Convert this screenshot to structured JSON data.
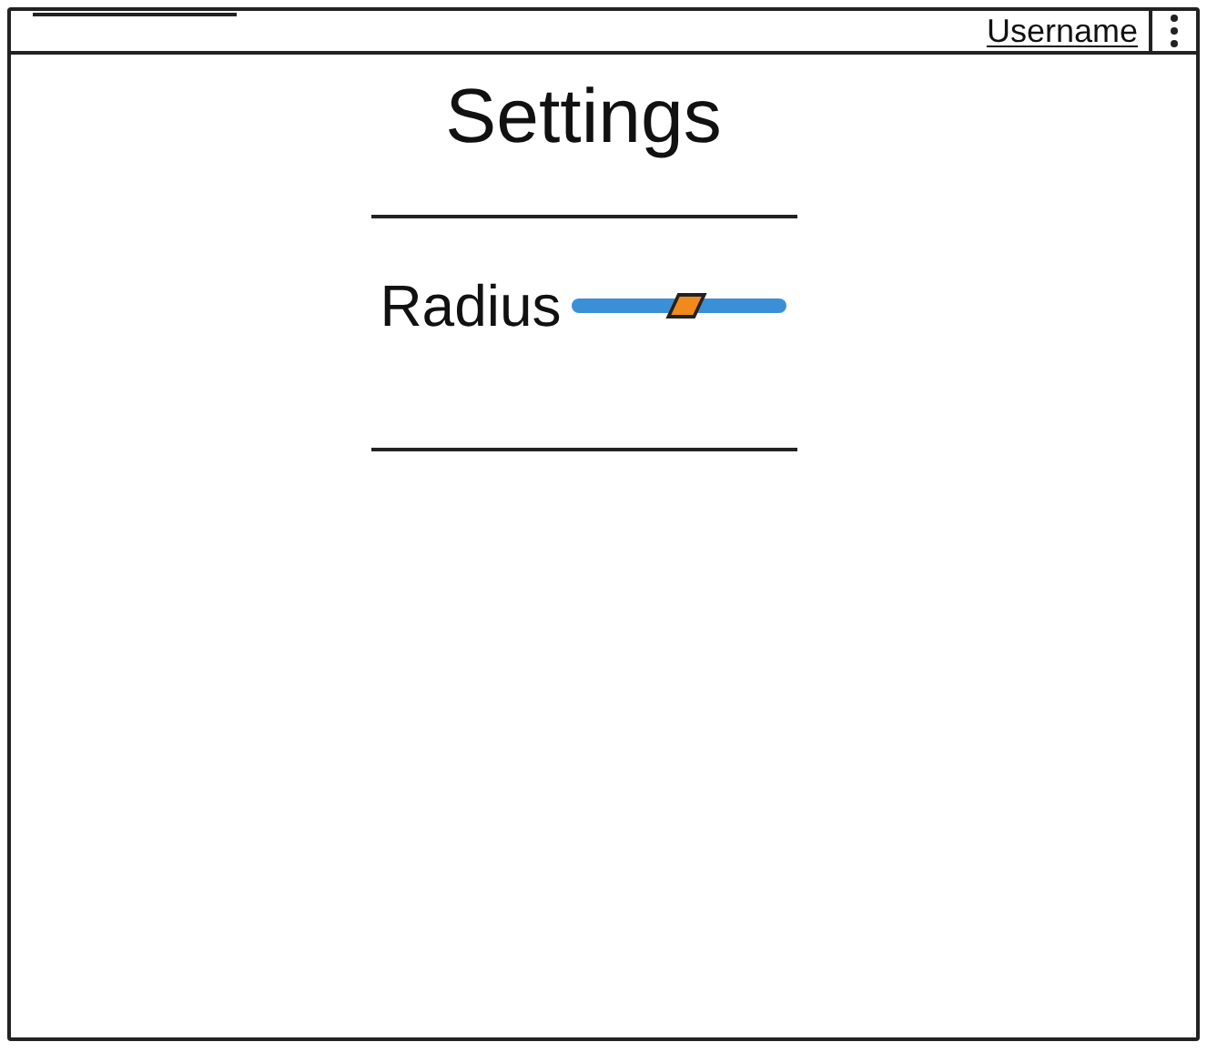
{
  "top_bar": {
    "username": "Username"
  },
  "page": {
    "title": "Settings"
  },
  "settings": [
    {
      "kind": "slider",
      "label": "Radius",
      "level": 0.53
    }
  ]
}
